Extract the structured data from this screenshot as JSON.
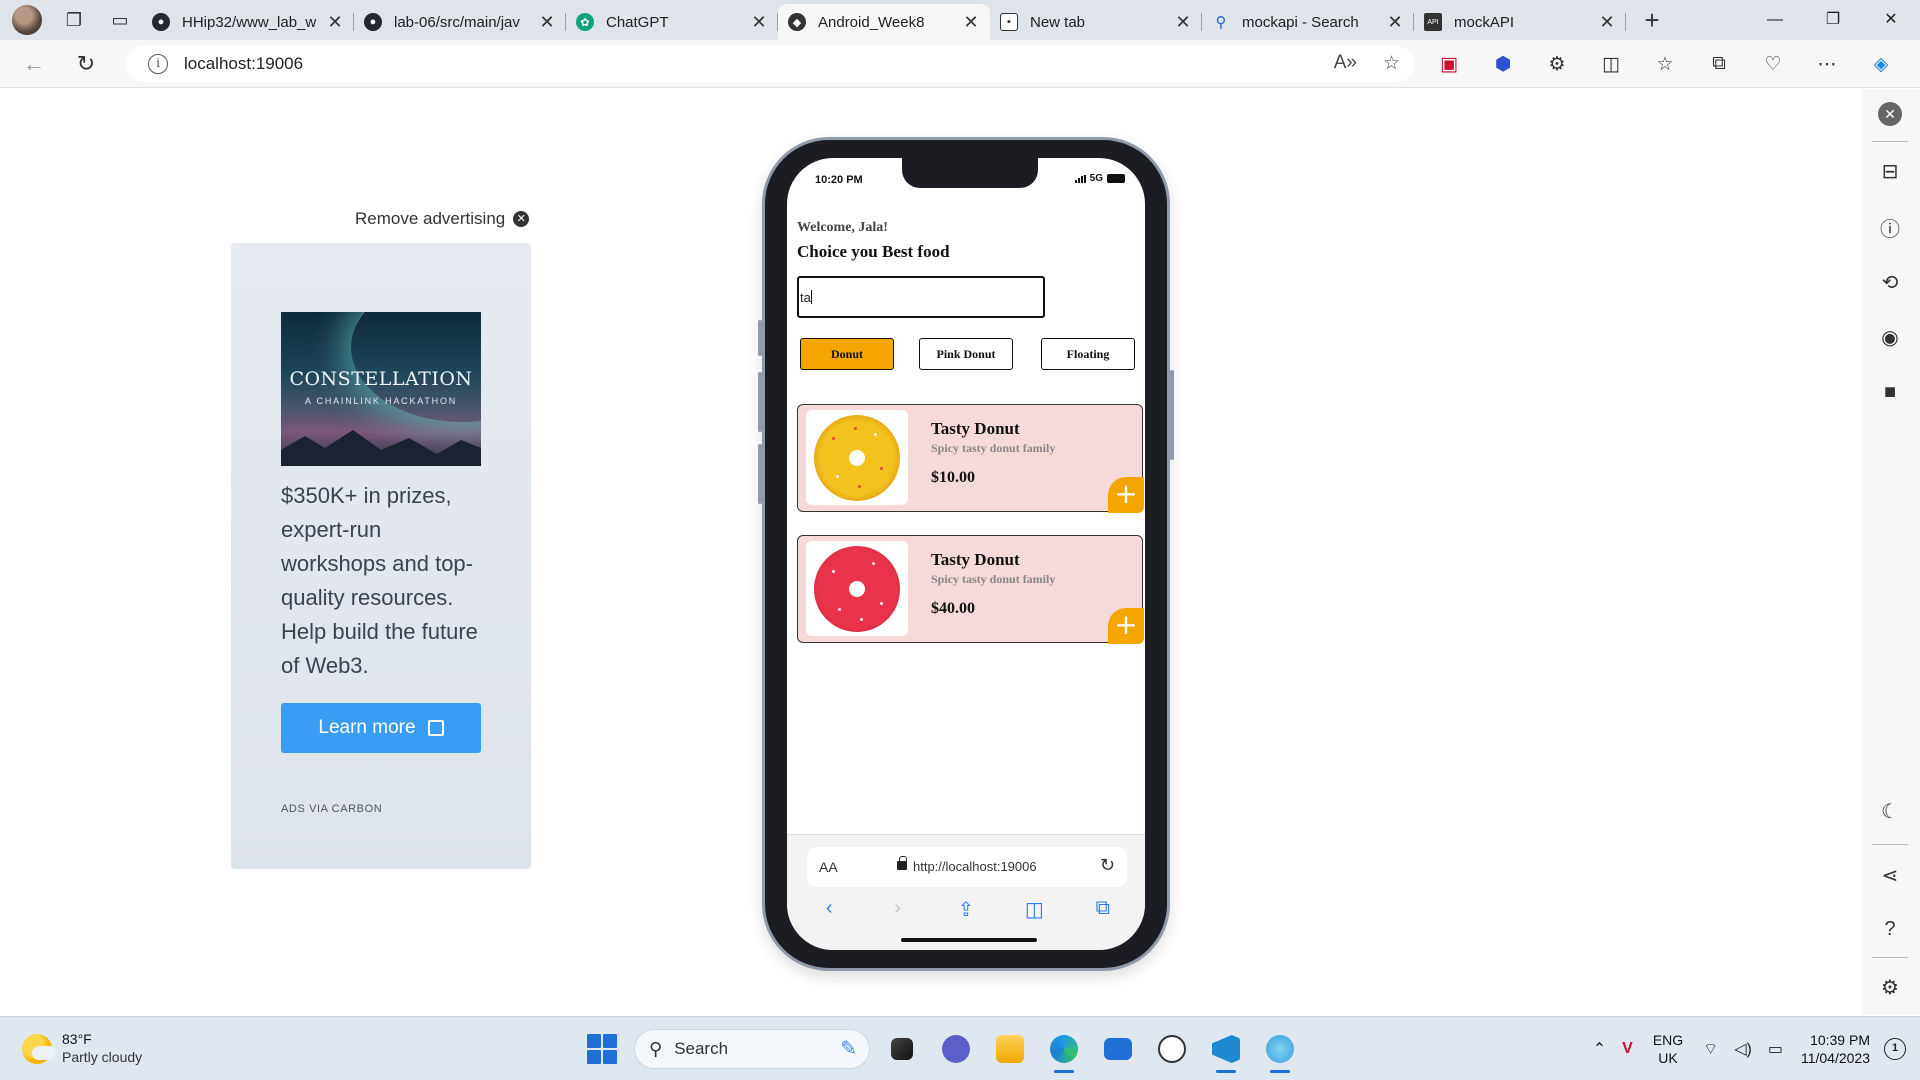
{
  "browser": {
    "tabs": [
      {
        "title": "HHip32/www_lab_w",
        "icon": "github-icon",
        "active": false
      },
      {
        "title": "lab-06/src/main/jav",
        "icon": "github-icon",
        "active": false
      },
      {
        "title": "ChatGPT",
        "icon": "chatgpt-icon",
        "active": false
      },
      {
        "title": "Android_Week8",
        "icon": "expo-icon",
        "active": true
      },
      {
        "title": "New tab",
        "icon": "newtab-icon",
        "active": false
      },
      {
        "title": "mockapi - Search",
        "icon": "search-icon",
        "active": false
      },
      {
        "title": "mockAPI",
        "icon": "mockapi-icon",
        "active": false
      }
    ],
    "address": "localhost:19006"
  },
  "ad": {
    "remove_label": "Remove advertising",
    "image_title": "CONSTELLATION",
    "image_subtitle": "A CHAINLINK HACKATHON",
    "body": "$350K+ in prizes, expert-run workshops and top-quality resources. Help build the future of Web3.",
    "button_label": "Learn more",
    "footer": "ADS VIA CARBON"
  },
  "phone": {
    "status_time": "10:20 PM",
    "status_network": "5G",
    "welcome": "Welcome, Jala!",
    "heading": "Choice you Best food",
    "search_value": "ta",
    "categories": [
      {
        "label": "Donut",
        "active": true
      },
      {
        "label": "Pink Donut",
        "active": false
      },
      {
        "label": "Floating",
        "active": false
      }
    ],
    "products": [
      {
        "name": "Tasty Donut",
        "description": "Spicy tasty donut family",
        "price": "$10.00",
        "donut_color": "yellow"
      },
      {
        "name": "Tasty Donut",
        "description": "Spicy tasty donut family",
        "price": "$40.00",
        "donut_color": "pink"
      }
    ],
    "safari": {
      "aa_label": "AA",
      "url": "http://localhost:19006"
    }
  },
  "taskbar": {
    "weather_temp": "83°F",
    "weather_desc": "Partly cloudy",
    "search_label": "Search",
    "lang_top": "ENG",
    "lang_bottom": "UK",
    "time": "10:39 PM",
    "date": "11/04/2023",
    "notification_count": "1"
  },
  "colors": {
    "accent": "#f4a500",
    "card_bg": "#f6d9d9",
    "ad_button": "#3a9cf3"
  }
}
